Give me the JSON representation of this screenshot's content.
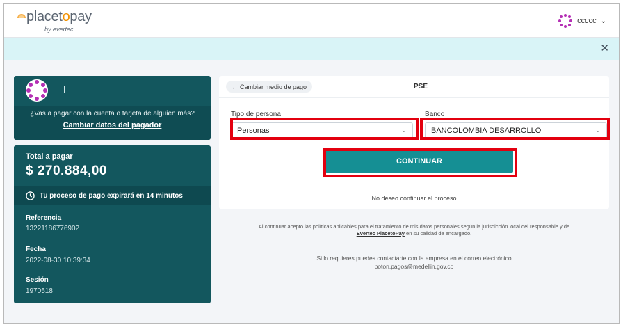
{
  "brand": {
    "name_part1": "placet",
    "name_o": "o",
    "name_part2": "pay",
    "tagline": "by evertec"
  },
  "user": {
    "name": "ccccc"
  },
  "payer": {
    "question": "¿Vas a pagar con la cuenta o tarjeta de alguien más?",
    "change_link": "Cambiar datos del pagador"
  },
  "summary": {
    "total_label": "Total a pagar",
    "total_amount": "$ 270.884,00",
    "expire_text": "Tu proceso de pago expirará en 14 minutos",
    "reference_label": "Referencia",
    "reference_value": "13221186776902",
    "date_label": "Fecha",
    "date_value": "2022-08-30 10:39:34",
    "session_label": "Sesión",
    "session_value": "1970518"
  },
  "form": {
    "back_label": "Cambiar medio de pago",
    "method_title": "PSE",
    "person_type_label": "Tipo de persona",
    "person_type_value": "Personas",
    "bank_label": "Banco",
    "bank_value": "BANCOLOMBIA DESARROLLO",
    "continue_label": "CONTINUAR",
    "cancel_label": "No deseo continuar el proceso"
  },
  "legal": {
    "line1": "Al continuar acepto las políticas aplicables para el tratamiento de mis datos personales según la jurisdicción local del responsable y de",
    "link": "Evertec PlacetoPay",
    "line2": "en su calidad de encargado."
  },
  "contact": {
    "line1": "Si lo requieres puedes contactarte con la empresa en el correo electrónico",
    "email": "boton.pagos@medellin.gov.co"
  },
  "colors": {
    "brand_orange": "#f39200",
    "teal_dark": "#13575e",
    "teal_button": "#158f94",
    "highlight": "#e3000f",
    "alert_bg": "#d9f4f7"
  }
}
